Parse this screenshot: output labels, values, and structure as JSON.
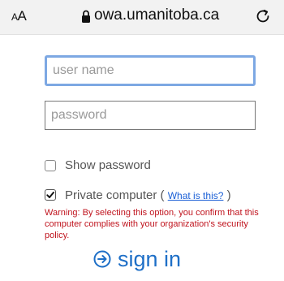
{
  "browser": {
    "text_size_button": {
      "small": "A",
      "large": "A"
    },
    "url": "owa.umanitoba.ca",
    "lock_icon": "lock-icon",
    "reload_icon": "reload-icon"
  },
  "login": {
    "username": {
      "placeholder": "user name",
      "value": ""
    },
    "password": {
      "placeholder": "password",
      "value": ""
    },
    "show_password": {
      "label": "Show password",
      "checked": false
    },
    "private_computer": {
      "label": "Private computer (",
      "link": "What is this?",
      "close": ")",
      "checked": true
    },
    "warning": "Warning: By selecting this option, you confirm that this computer complies with your organization's security policy.",
    "signin": {
      "label": "sign in",
      "icon": "arrow-circle-right-icon"
    }
  },
  "colors": {
    "accent": "#1e6fc7",
    "focus_border": "#7da8e3",
    "warning": "#c0141e",
    "link": "#1a5fd6"
  }
}
